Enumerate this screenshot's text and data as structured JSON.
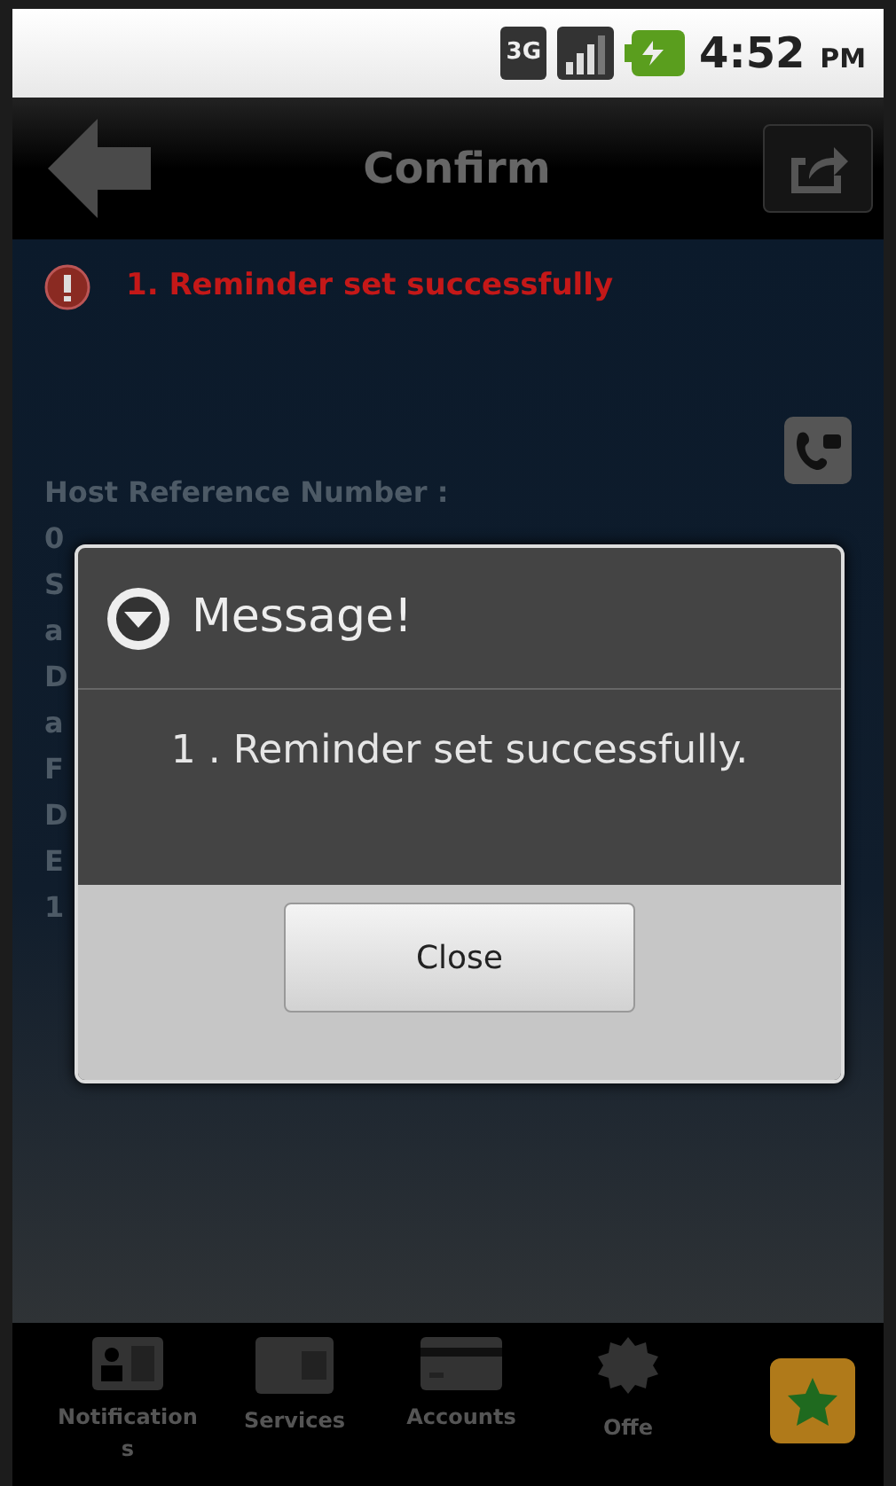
{
  "status_bar": {
    "network": "3G",
    "time": "4:52",
    "ampm": "PM"
  },
  "title_bar": {
    "title": "Confirm"
  },
  "alert": {
    "text": "1. Reminder set successfully"
  },
  "details": [
    "Host Reference Number :",
    "0",
    "S",
    "a",
    "D",
    "a",
    "F",
    "D",
    "E",
    "1"
  ],
  "dialog": {
    "title": "Message!",
    "message": "1 . Reminder set successfully.",
    "button": "Close"
  },
  "tabs": [
    {
      "label": "Notifications"
    },
    {
      "label": "Services"
    },
    {
      "label": "Accounts"
    },
    {
      "label": "Offe"
    }
  ]
}
